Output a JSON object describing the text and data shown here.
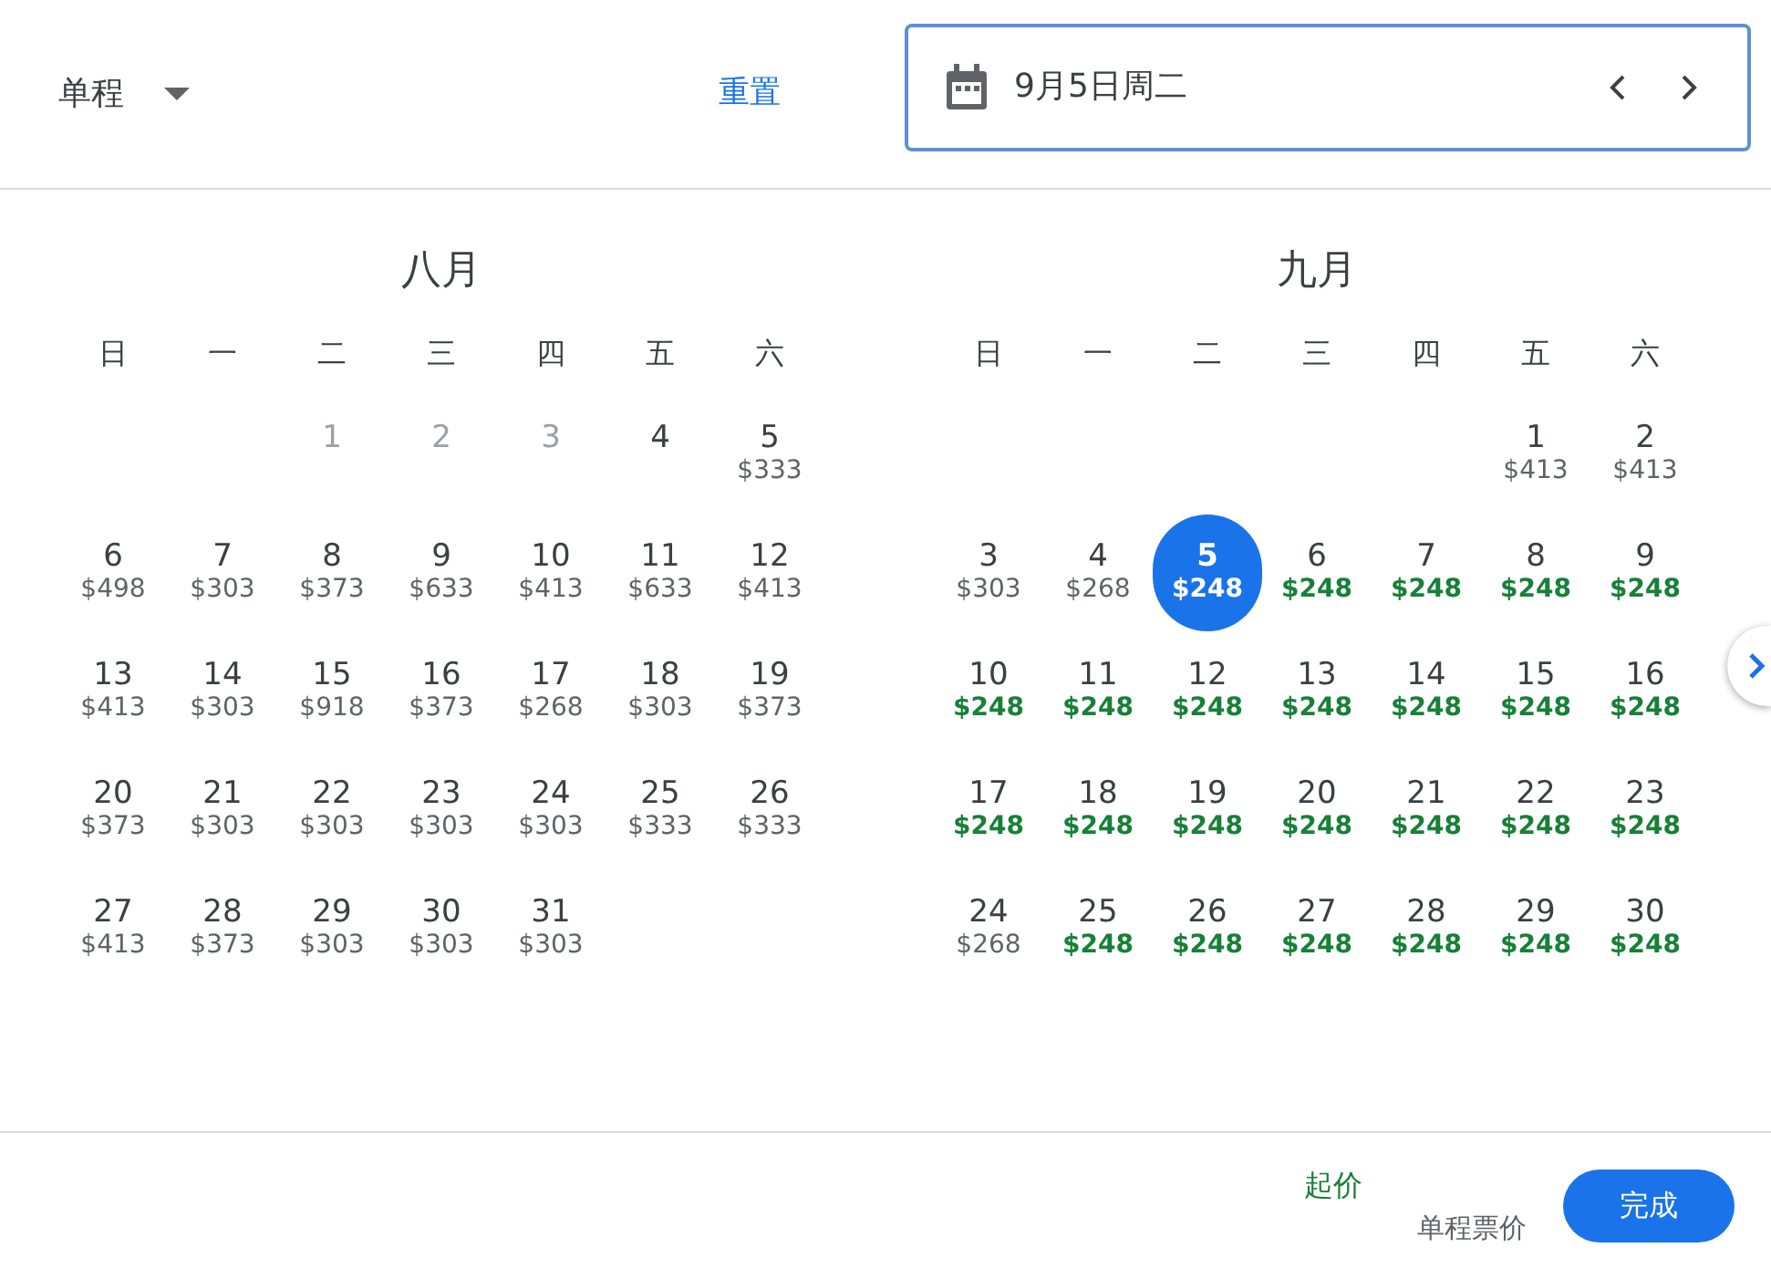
{
  "trip_type": {
    "label": "单程"
  },
  "reset": "重置",
  "date_field": {
    "value": "9月5日周二"
  },
  "months": [
    {
      "title": "八月",
      "weekdays": [
        "日",
        "一",
        "二",
        "三",
        "四",
        "五",
        "六"
      ],
      "weeks": [
        {
          "days": [
            {
              "day": "1",
              "disabled": true,
              "selected": false
            },
            {
              "day": "2",
              "disabled": true,
              "selected": false
            },
            {
              "day": "3",
              "disabled": true,
              "selected": false
            },
            {
              "day": "4",
              "disabled": false,
              "selected": false
            },
            {
              "day": "5",
              "price": "$333",
              "cheap": false,
              "disabled": false,
              "selected": false
            }
          ]
        },
        {
          "days": [
            {
              "day": "6",
              "price": "$498",
              "cheap": false,
              "disabled": false,
              "selected": false
            },
            {
              "day": "7",
              "price": "$303",
              "cheap": false,
              "disabled": false,
              "selected": false
            },
            {
              "day": "8",
              "price": "$373",
              "cheap": false,
              "disabled": false,
              "selected": false
            },
            {
              "day": "9",
              "price": "$633",
              "cheap": false,
              "disabled": false,
              "selected": false
            },
            {
              "day": "10",
              "price": "$413",
              "cheap": false,
              "disabled": false,
              "selected": false
            },
            {
              "day": "11",
              "price": "$633",
              "cheap": false,
              "disabled": false,
              "selected": false
            },
            {
              "day": "12",
              "price": "$413",
              "cheap": false,
              "disabled": false,
              "selected": false
            }
          ]
        },
        {
          "days": [
            {
              "day": "13",
              "price": "$413",
              "cheap": false,
              "disabled": false,
              "selected": false
            },
            {
              "day": "14",
              "price": "$303",
              "cheap": false,
              "disabled": false,
              "selected": false
            },
            {
              "day": "15",
              "price": "$918",
              "cheap": false,
              "disabled": false,
              "selected": false
            },
            {
              "day": "16",
              "price": "$373",
              "cheap": false,
              "disabled": false,
              "selected": false
            },
            {
              "day": "17",
              "price": "$268",
              "cheap": false,
              "disabled": false,
              "selected": false
            },
            {
              "day": "18",
              "price": "$303",
              "cheap": false,
              "disabled": false,
              "selected": false
            },
            {
              "day": "19",
              "price": "$373",
              "cheap": false,
              "disabled": false,
              "selected": false
            }
          ]
        },
        {
          "days": [
            {
              "day": "20",
              "price": "$373",
              "cheap": false,
              "disabled": false,
              "selected": false
            },
            {
              "day": "21",
              "price": "$303",
              "cheap": false,
              "disabled": false,
              "selected": false
            },
            {
              "day": "22",
              "price": "$303",
              "cheap": false,
              "disabled": false,
              "selected": false
            },
            {
              "day": "23",
              "price": "$303",
              "cheap": false,
              "disabled": false,
              "selected": false
            },
            {
              "day": "24",
              "price": "$303",
              "cheap": false,
              "disabled": false,
              "selected": false
            },
            {
              "day": "25",
              "price": "$333",
              "cheap": false,
              "disabled": false,
              "selected": false
            },
            {
              "day": "26",
              "price": "$333",
              "cheap": false,
              "disabled": false,
              "selected": false
            }
          ]
        },
        {
          "days": [
            {
              "day": "27",
              "price": "$413",
              "cheap": false,
              "disabled": false,
              "selected": false
            },
            {
              "day": "28",
              "price": "$373",
              "cheap": false,
              "disabled": false,
              "selected": false
            },
            {
              "day": "29",
              "price": "$303",
              "cheap": false,
              "disabled": false,
              "selected": false
            },
            {
              "day": "30",
              "price": "$303",
              "cheap": false,
              "disabled": false,
              "selected": false
            },
            {
              "day": "31",
              "price": "$303",
              "cheap": false,
              "disabled": false,
              "selected": false
            }
          ]
        }
      ]
    },
    {
      "title": "九月",
      "weekdays": [
        "日",
        "一",
        "二",
        "三",
        "四",
        "五",
        "六"
      ],
      "weeks": [
        {
          "days": [
            {
              "day": "1",
              "price": "$413",
              "cheap": false,
              "disabled": false,
              "selected": false
            },
            {
              "day": "2",
              "price": "$413",
              "cheap": false,
              "disabled": false,
              "selected": false
            }
          ]
        },
        {
          "days": [
            {
              "day": "3",
              "price": "$303",
              "cheap": false,
              "disabled": false,
              "selected": false
            },
            {
              "day": "4",
              "price": "$268",
              "cheap": false,
              "disabled": false,
              "selected": false
            },
            {
              "day": "5",
              "price": "$248",
              "disabled": false,
              "selected": true
            },
            {
              "day": "6",
              "price": "$248",
              "cheap": true,
              "disabled": false,
              "selected": false
            },
            {
              "day": "7",
              "price": "$248",
              "cheap": true,
              "disabled": false,
              "selected": false
            },
            {
              "day": "8",
              "price": "$248",
              "cheap": true,
              "disabled": false,
              "selected": false
            },
            {
              "day": "9",
              "price": "$248",
              "cheap": true,
              "disabled": false,
              "selected": false
            }
          ]
        },
        {
          "days": [
            {
              "day": "10",
              "price": "$248",
              "cheap": true,
              "disabled": false,
              "selected": false
            },
            {
              "day": "11",
              "price": "$248",
              "cheap": true,
              "disabled": false,
              "selected": false
            },
            {
              "day": "12",
              "price": "$248",
              "cheap": true,
              "disabled": false,
              "selected": false
            },
            {
              "day": "13",
              "price": "$248",
              "cheap": true,
              "disabled": false,
              "selected": false
            },
            {
              "day": "14",
              "price": "$248",
              "cheap": true,
              "disabled": false,
              "selected": false
            },
            {
              "day": "15",
              "price": "$248",
              "cheap": true,
              "disabled": false,
              "selected": false
            },
            {
              "day": "16",
              "price": "$248",
              "cheap": true,
              "disabled": false,
              "selected": false
            }
          ]
        },
        {
          "days": [
            {
              "day": "17",
              "price": "$248",
              "cheap": true,
              "disabled": false,
              "selected": false
            },
            {
              "day": "18",
              "price": "$248",
              "cheap": true,
              "disabled": false,
              "selected": false
            },
            {
              "day": "19",
              "price": "$248",
              "cheap": true,
              "disabled": false,
              "selected": false
            },
            {
              "day": "20",
              "price": "$248",
              "cheap": true,
              "disabled": false,
              "selected": false
            },
            {
              "day": "21",
              "price": "$248",
              "cheap": true,
              "disabled": false,
              "selected": false
            },
            {
              "day": "22",
              "price": "$248",
              "cheap": true,
              "disabled": false,
              "selected": false
            },
            {
              "day": "23",
              "price": "$248",
              "cheap": true,
              "disabled": false,
              "selected": false
            }
          ]
        },
        {
          "days": [
            {
              "day": "24",
              "price": "$268",
              "cheap": false,
              "disabled": false,
              "selected": false
            },
            {
              "day": "25",
              "price": "$248",
              "cheap": true,
              "disabled": false,
              "selected": false
            },
            {
              "day": "26",
              "price": "$248",
              "cheap": true,
              "disabled": false,
              "selected": false
            },
            {
              "day": "27",
              "price": "$248",
              "cheap": true,
              "disabled": false,
              "selected": false
            },
            {
              "day": "28",
              "price": "$248",
              "cheap": true,
              "disabled": false,
              "selected": false
            },
            {
              "day": "29",
              "price": "$248",
              "cheap": true,
              "disabled": false,
              "selected": false
            },
            {
              "day": "30",
              "price": "$248",
              "cheap": true,
              "disabled": false,
              "selected": false
            }
          ]
        }
      ]
    }
  ],
  "footer": {
    "price_label": "起价",
    "price_note": "单程票价",
    "done_button": "完成"
  }
}
